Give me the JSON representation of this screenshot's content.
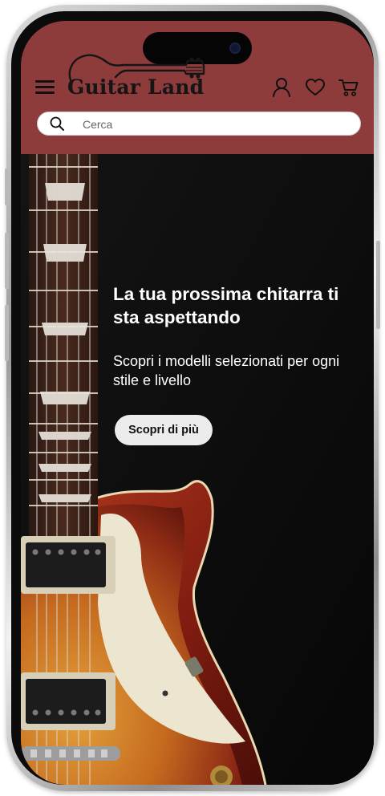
{
  "header": {
    "brand": "Guitar Land",
    "background_color": "#8d3b3b",
    "icons": [
      "menu-icon",
      "user-icon",
      "heart-icon",
      "cart-icon"
    ]
  },
  "search": {
    "placeholder": "Cerca",
    "icon": "search-icon"
  },
  "hero": {
    "title": "La tua prossima chitarra ti sta aspettando",
    "subtitle": "Scopri i modelli selezionati per ogni stile e livello",
    "cta_label": "Scopri di più",
    "image": "electric-guitar-photo"
  }
}
